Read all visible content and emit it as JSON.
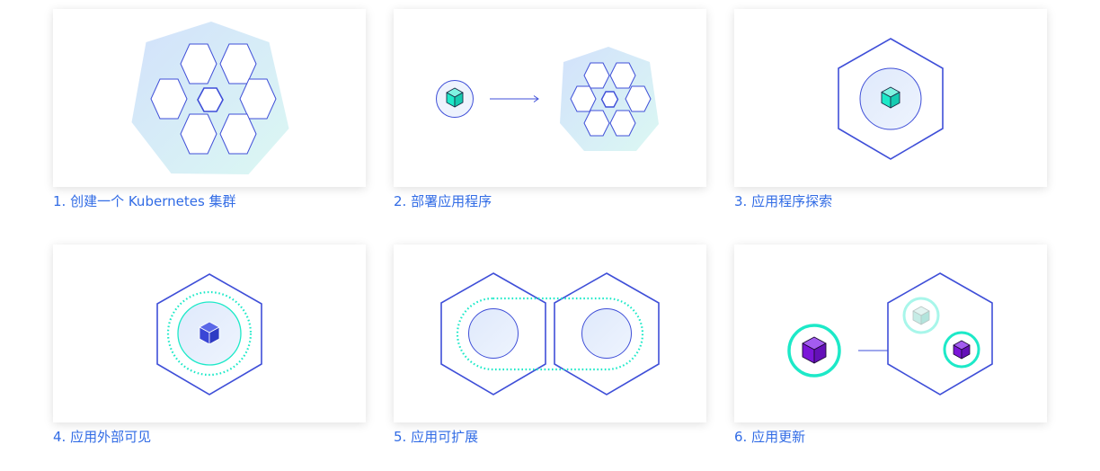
{
  "modules": [
    {
      "caption": "1. 创建一个 Kubernetes 集群",
      "illustration": "cluster-hexagons-icon"
    },
    {
      "caption": "2. 部署应用程序",
      "illustration": "deploy-app-icon"
    },
    {
      "caption": "3. 应用程序探索",
      "illustration": "explore-app-icon"
    },
    {
      "caption": "4. 应用外部可见",
      "illustration": "expose-app-icon"
    },
    {
      "caption": "5. 应用可扩展",
      "illustration": "scale-app-icon"
    },
    {
      "caption": "6. 应用更新",
      "illustration": "update-app-icon"
    }
  ],
  "colors": {
    "caption": "#326ce5",
    "outline": "#3f4fd8",
    "teal": "#1de9c8",
    "purple": "#7b16d8",
    "gradient_start": "#d3e3fb",
    "gradient_end": "#d8f7f2"
  }
}
